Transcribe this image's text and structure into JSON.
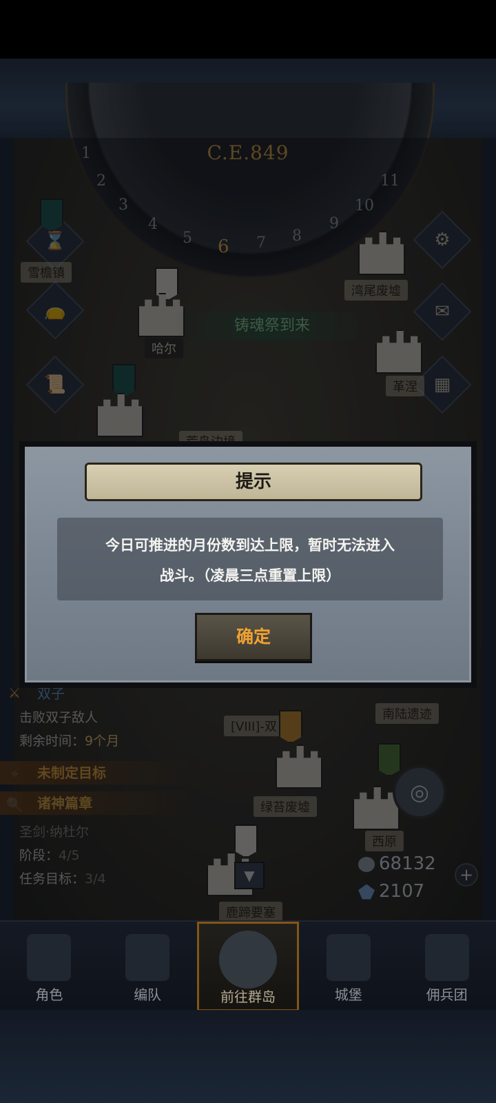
{
  "map": {
    "year": "C.E.849",
    "dial_numbers": [
      "1",
      "2",
      "3",
      "4",
      "5",
      "6",
      "7",
      "8",
      "9",
      "10",
      "11"
    ],
    "current_month": "6",
    "places": {
      "snow_town": "雪檐镇",
      "bay_ruins": "湾尾废墟",
      "frontier": "荒岛边境",
      "south_ruins": "南陆遗迹",
      "green_ruins": "绿苔废墟",
      "west_plain": "西原",
      "gemini_zone": "[VIII]-双",
      "haha": "哈尔",
      "gexi": "革涅",
      "bottom_castle": "鹿蹄要塞"
    },
    "event_banner": "铸魂祭到来"
  },
  "quest": {
    "title": "双子",
    "desc": "击败双子敌人",
    "time_label": "剩余时间：",
    "time_value": "9个月",
    "goal_unset": "未制定目标",
    "chapter": "诸神篇章",
    "chapter_hero": "圣剑·纳杜尔",
    "stage_label": "阶段：",
    "stage_value": "4/5",
    "task_label": "任务目标：",
    "task_value": "3/4"
  },
  "resources": {
    "silver": "68132",
    "crystal": "2107",
    "plus": "+"
  },
  "bottom_nav": [
    {
      "label": "角色"
    },
    {
      "label": "编队"
    },
    {
      "label": "前往群岛"
    },
    {
      "label": "城堡"
    },
    {
      "label": "佣兵团"
    }
  ],
  "dialog": {
    "title": "提示",
    "message_line1": "今日可推进的月份数到达上限，暂时无法进入",
    "message_line2": "战斗。（凌晨三点重置上限）",
    "confirm": "确定"
  },
  "icons": {
    "settings": "gear-icon",
    "mail": "envelope-icon",
    "hourglass": "hourglass-icon",
    "bag": "bag-icon",
    "scroll": "scroll-icon",
    "grid": "grid-icon",
    "locate": "crosshair-icon"
  }
}
